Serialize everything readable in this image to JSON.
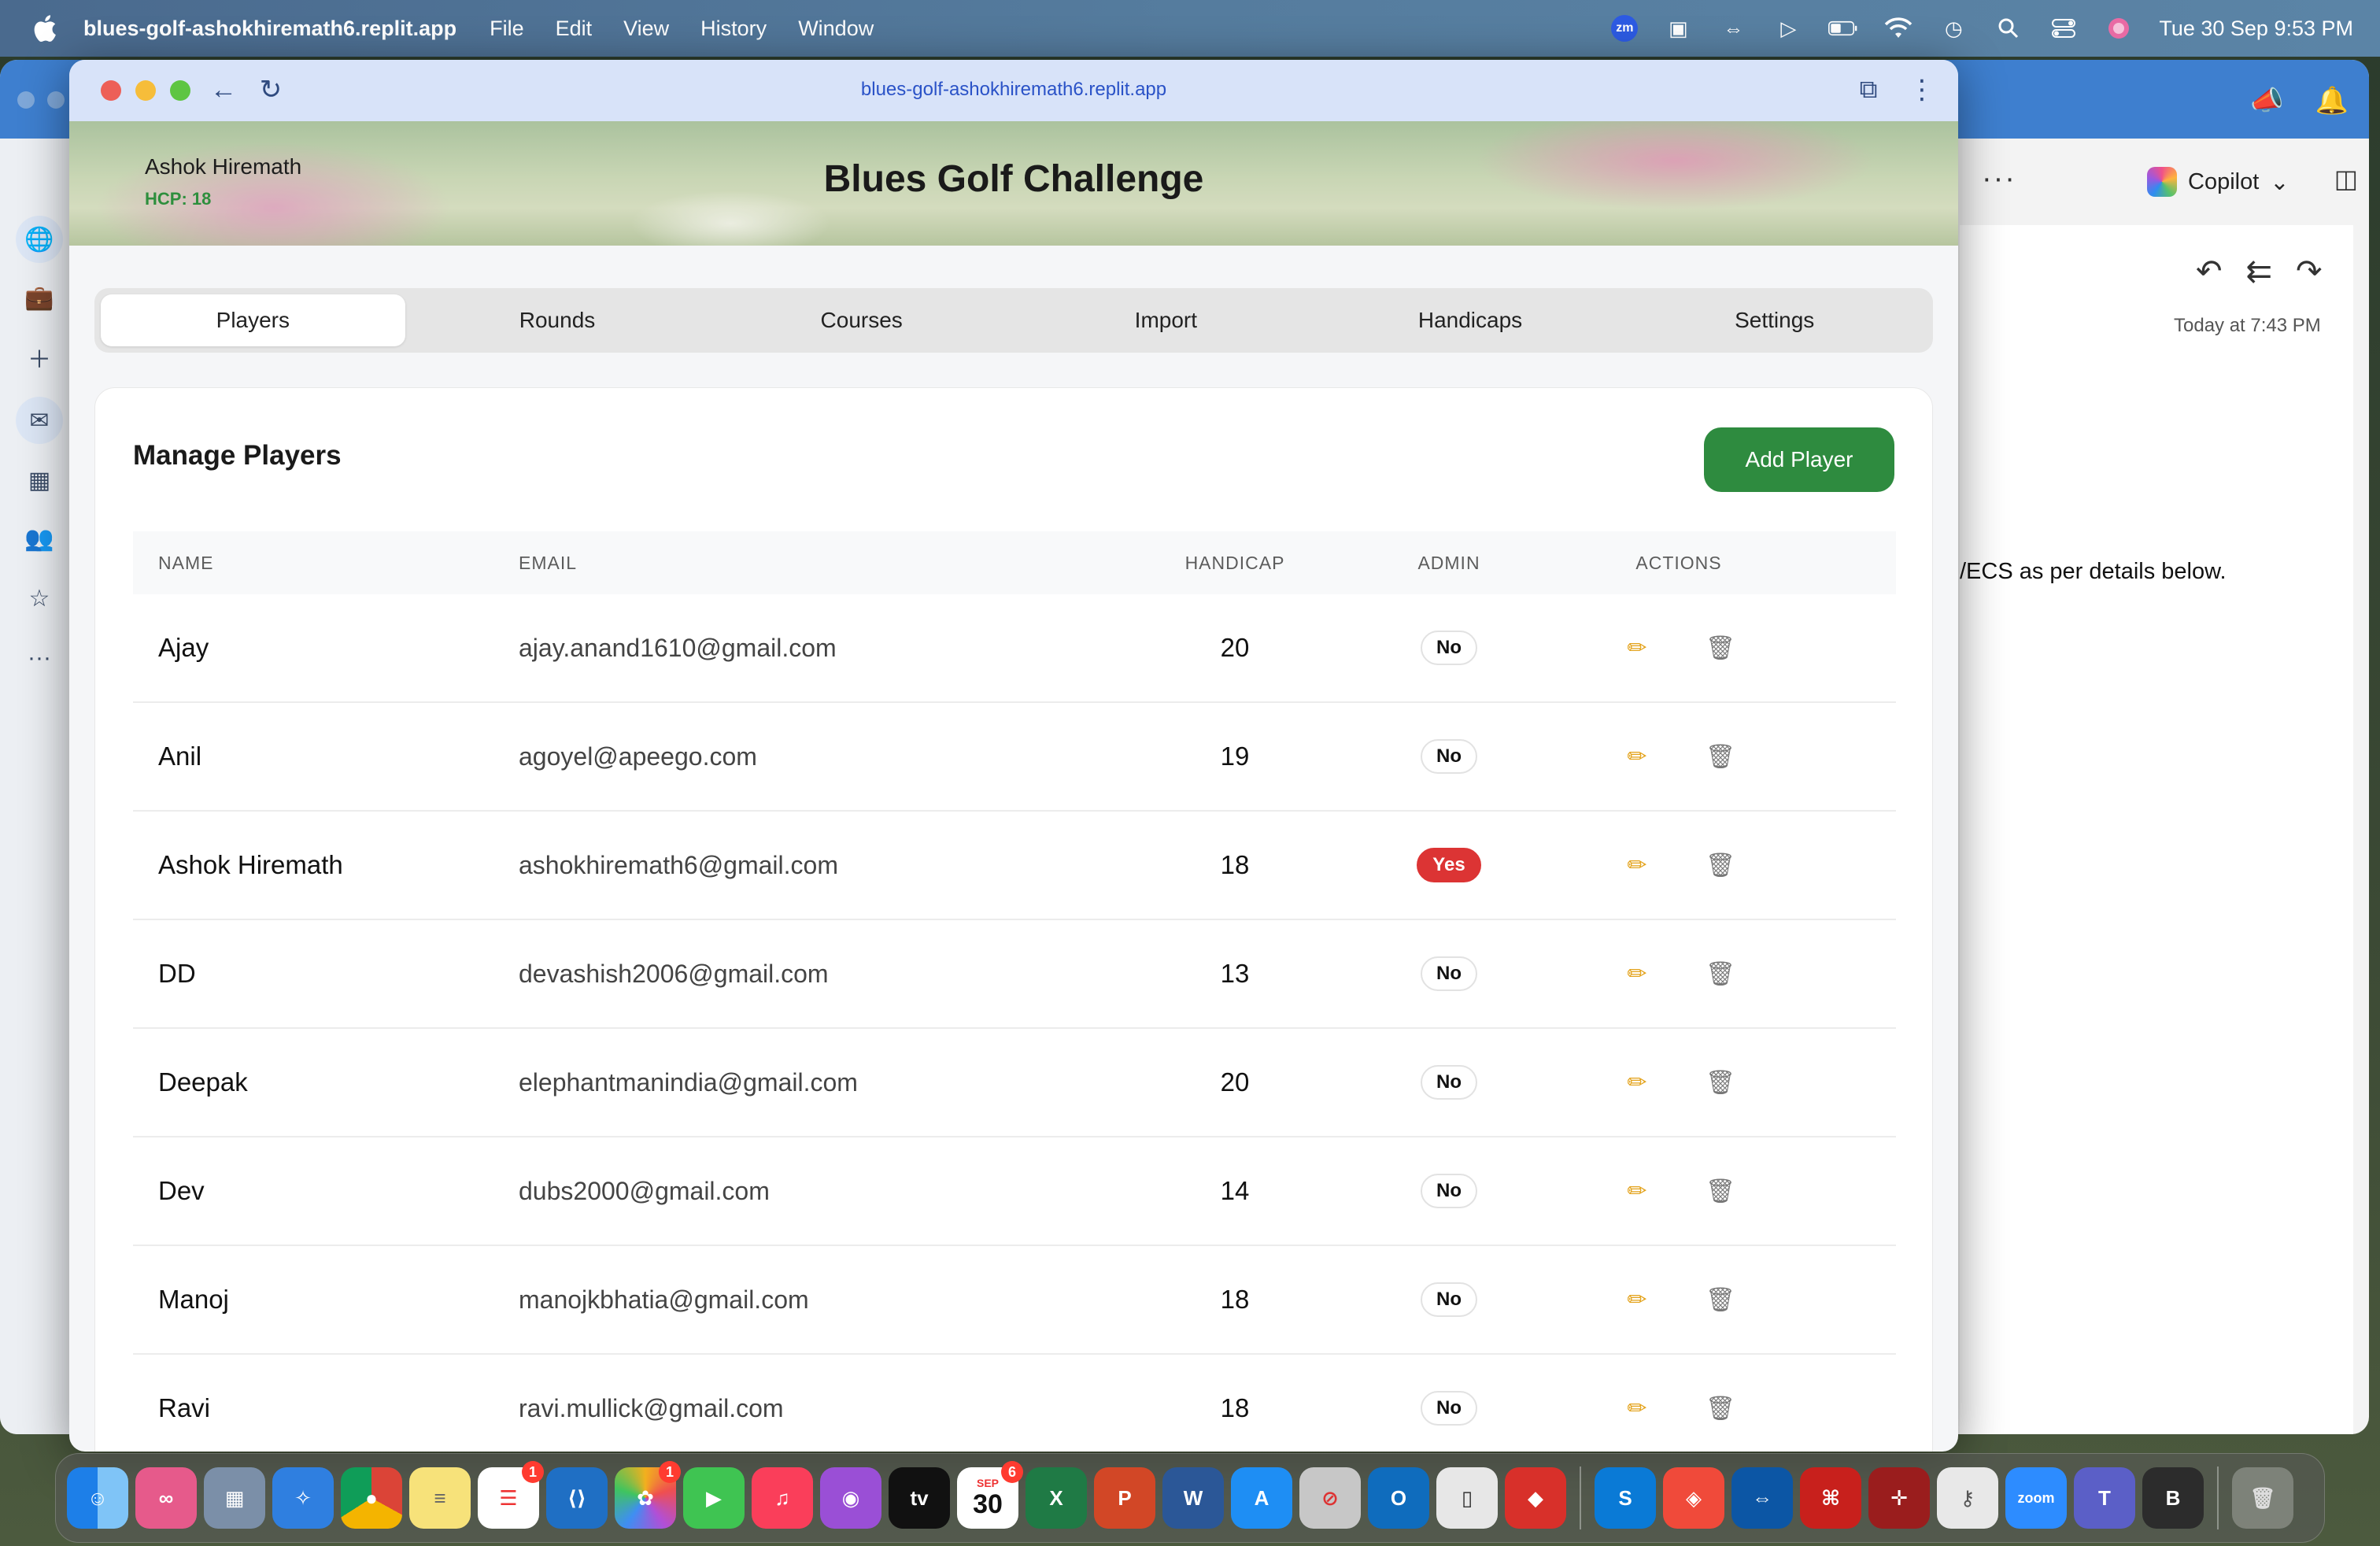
{
  "menubar": {
    "app_name": "blues-golf-ashokhiremath6.replit.app",
    "menus": [
      "File",
      "Edit",
      "View",
      "History",
      "Window"
    ],
    "zoom_label": "zm",
    "clock": "Tue 30 Sep  9:53 PM"
  },
  "browser": {
    "url": "blues-golf-ashokhiremath6.replit.app"
  },
  "header": {
    "user_name": "Ashok Hiremath",
    "user_hcp": "HCP: 18",
    "title": "Blues Golf Challenge"
  },
  "tabs": [
    {
      "label": "Players",
      "active": true
    },
    {
      "label": "Rounds",
      "active": false
    },
    {
      "label": "Courses",
      "active": false
    },
    {
      "label": "Import",
      "active": false
    },
    {
      "label": "Handicaps",
      "active": false
    },
    {
      "label": "Settings",
      "active": false
    }
  ],
  "players_panel": {
    "title": "Manage Players",
    "add_button": "Add Player",
    "columns": [
      "NAME",
      "EMAIL",
      "HANDICAP",
      "ADMIN",
      "ACTIONS"
    ],
    "rows": [
      {
        "name": "Ajay",
        "email": "ajay.anand1610@gmail.com",
        "handicap": "20",
        "admin": "No"
      },
      {
        "name": "Anil",
        "email": "agoyel@apeego.com",
        "handicap": "19",
        "admin": "No"
      },
      {
        "name": "Ashok Hiremath",
        "email": "ashokhiremath6@gmail.com",
        "handicap": "18",
        "admin": "Yes"
      },
      {
        "name": "DD",
        "email": "devashish2006@gmail.com",
        "handicap": "13",
        "admin": "No"
      },
      {
        "name": "Deepak",
        "email": "elephantmanindia@gmail.com",
        "handicap": "20",
        "admin": "No"
      },
      {
        "name": "Dev",
        "email": "dubs2000@gmail.com",
        "handicap": "14",
        "admin": "No"
      },
      {
        "name": "Manoj",
        "email": "manojkbhatia@gmail.com",
        "handicap": "18",
        "admin": "No"
      },
      {
        "name": "Ravi",
        "email": "ravi.mullick@gmail.com",
        "handicap": "18",
        "admin": "No"
      }
    ]
  },
  "outlook": {
    "copilot_label": "Copilot",
    "mail_date": "Today at 7:43 PM",
    "mail_body_fragment": "/ECS as per details below."
  },
  "dock": {
    "calendar_month": "SEP",
    "calendar_day": "30",
    "badges": {
      "reminders": "1",
      "photos": "1",
      "calendar": "6"
    },
    "zoom_label": "zoom",
    "tv_label": "tv",
    "bbedit_label": "B"
  },
  "colors": {
    "accent_green": "#2e8b3f",
    "admin_yes": "#dc3434",
    "url_blue": "#2a52c7"
  }
}
